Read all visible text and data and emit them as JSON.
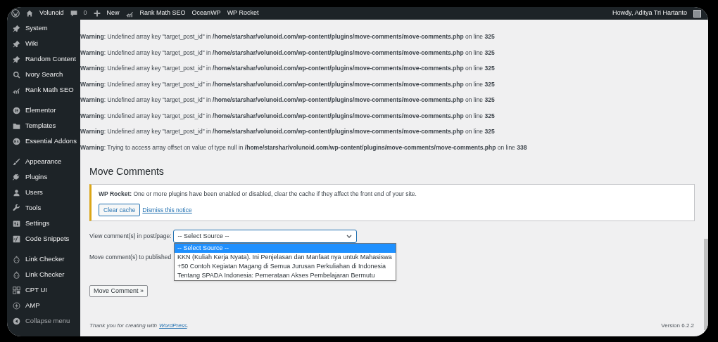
{
  "admin_bar": {
    "items": [
      {
        "kind": "logo"
      },
      {
        "kind": "home",
        "label": "Volunoid"
      },
      {
        "kind": "comments",
        "label": "0"
      },
      {
        "kind": "new",
        "label": "New"
      },
      {
        "kind": "chart",
        "label": "Rank Math SEO"
      },
      {
        "kind": "text",
        "label": "OceanWP"
      },
      {
        "kind": "text",
        "label": "WP Rocket"
      }
    ],
    "greeting": "Howdy, Aditya Tri Hartanto"
  },
  "sidebar": {
    "sections": [
      {
        "items": [
          {
            "kind": "pin",
            "label": "System"
          },
          {
            "kind": "pin",
            "label": "Wiki"
          },
          {
            "kind": "pin",
            "label": "Random Content"
          },
          {
            "kind": "search",
            "label": "Ivory Search"
          },
          {
            "kind": "chart",
            "label": "Rank Math SEO"
          }
        ]
      },
      {
        "items": [
          {
            "kind": "elementor",
            "label": "Elementor"
          },
          {
            "kind": "folder",
            "label": "Templates"
          },
          {
            "kind": "addons",
            "label": "Essential Addons"
          }
        ]
      },
      {
        "items": [
          {
            "kind": "brush",
            "label": "Appearance"
          },
          {
            "kind": "plug",
            "label": "Plugins"
          },
          {
            "kind": "user",
            "label": "Users"
          },
          {
            "kind": "wrench",
            "label": "Tools"
          },
          {
            "kind": "settings",
            "label": "Settings"
          },
          {
            "kind": "code",
            "label": "Code Snippets"
          }
        ]
      },
      {
        "items": [
          {
            "kind": "face",
            "label": "Link Checker"
          },
          {
            "kind": "face",
            "label": "Link Checker"
          },
          {
            "kind": "grid",
            "label": "CPT UI"
          },
          {
            "kind": "bolt",
            "label": "AMP"
          },
          {
            "kind": "collapse",
            "label": "Collapse menu"
          }
        ]
      }
    ]
  },
  "warnings": [
    "**Warning**: Undefined array key \"target_post_id\" in **/home/starshar/volunoid.com/wp-content/plugins/move-comments/move-comments.php** on line **325**",
    "**Warning**: Undefined array key \"target_post_id\" in **/home/starshar/volunoid.com/wp-content/plugins/move-comments/move-comments.php** on line **325**",
    "**Warning**: Undefined array key \"target_post_id\" in **/home/starshar/volunoid.com/wp-content/plugins/move-comments/move-comments.php** on line **325**",
    "**Warning**: Undefined array key \"target_post_id\" in **/home/starshar/volunoid.com/wp-content/plugins/move-comments/move-comments.php** on line **325**",
    "**Warning**: Undefined array key \"target_post_id\" in **/home/starshar/volunoid.com/wp-content/plugins/move-comments/move-comments.php** on line **325**",
    "**Warning**: Undefined array key \"target_post_id\" in **/home/starshar/volunoid.com/wp-content/plugins/move-comments/move-comments.php** on line **325**",
    "**Warning**: Undefined array key \"target_post_id\" in **/home/starshar/volunoid.com/wp-content/plugins/move-comments/move-comments.php** on line **325**",
    "**Warning**: Trying to access array offset on value of type null in **/home/starshar/volunoid.com/wp-content/plugins/move-comments/move-comments.php** on line **338**"
  ],
  "page_title": "Move Comments",
  "notice": {
    "text": "**WP Rocket:** One or more plugins have been enabled or disabled, clear the cache if they affect the front end of your site.",
    "button": "Clear cache",
    "link": "Dismiss this notice"
  },
  "view_field": {
    "label": "View comment(s) in post/page:",
    "value": "-- Select Source --",
    "expanded": true,
    "options": [
      {
        "label": "-- Select Source --",
        "selected": true
      },
      {
        "label": "KKN (Kuliah Kerja Nyata). Ini Penjelasan dan Manfaat nya untuk Mahasiswa",
        "selected": false
      },
      {
        "label": "+50 Contoh Kegiatan Magang di Semua Jurusan Perkuliahan di Indonesia",
        "selected": false
      },
      {
        "label": "Tentang SPADA Indonesia: Pemerataan Akses Pembelajaran Bermutu",
        "selected": false
      }
    ]
  },
  "move_label": "Move comment(s) to published",
  "move_button": "Move Comment »",
  "footer": {
    "text": "Thank you for creating with",
    "link": "WordPress",
    "suffix": ".",
    "version": "Version 6.2.2"
  }
}
